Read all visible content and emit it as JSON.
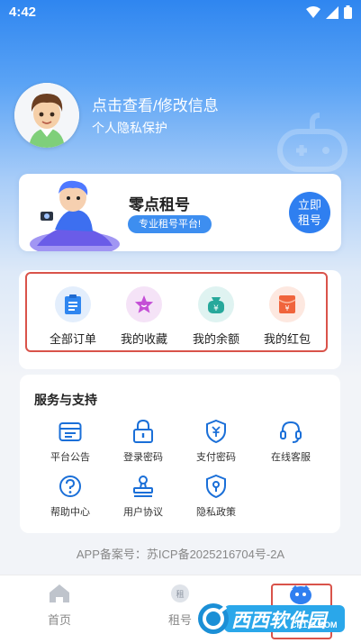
{
  "status_bar": {
    "time": "4:42"
  },
  "profile": {
    "name": "点击查看/修改信息",
    "subtitle": "个人隐私保护"
  },
  "banner": {
    "title": "零点租号",
    "tag": "专业租号平台!",
    "button_line1": "立即",
    "button_line2": "租号"
  },
  "quick_actions": [
    {
      "label": "全部订单",
      "icon": "clipboard-icon",
      "color": "#2f86f0"
    },
    {
      "label": "我的收藏",
      "icon": "star-icon",
      "color": "#c44fd6"
    },
    {
      "label": "我的余额",
      "icon": "wallet-icon",
      "color": "#27a89b"
    },
    {
      "label": "我的红包",
      "icon": "red-envelope-icon",
      "color": "#f0643c"
    }
  ],
  "services": {
    "title": "服务与支持",
    "items": [
      {
        "label": "平台公告",
        "icon": "notice-icon"
      },
      {
        "label": "登录密码",
        "icon": "lock-icon"
      },
      {
        "label": "支付密码",
        "icon": "payment-shield-icon"
      },
      {
        "label": "在线客服",
        "icon": "headset-icon"
      },
      {
        "label": "帮助中心",
        "icon": "help-icon"
      },
      {
        "label": "用户协议",
        "icon": "stamp-icon"
      },
      {
        "label": "隐私政策",
        "icon": "privacy-pin-icon"
      }
    ]
  },
  "icp": "APP备案号：苏ICP备2025216704号-2A",
  "tabbar": {
    "items": [
      {
        "label": "首页",
        "icon": "home-icon"
      },
      {
        "label": "租号",
        "icon": "rent-icon"
      },
      {
        "label": "",
        "icon": "profile-icon"
      }
    ]
  },
  "watermark": {
    "text": "西西软件园",
    "sub": "CR173.COM"
  },
  "colors": {
    "accent": "#2f7ff0",
    "highlight_outline": "#d9534a"
  }
}
